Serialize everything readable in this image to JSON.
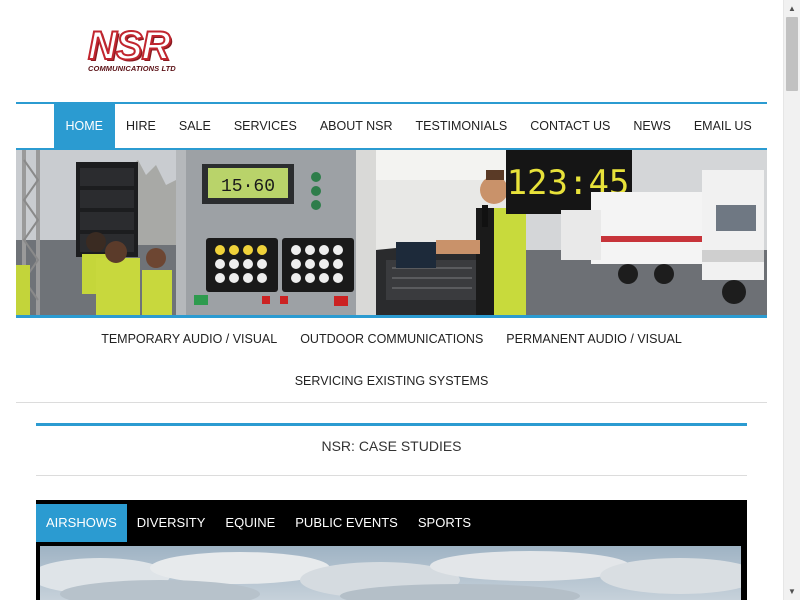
{
  "logo": {
    "main": "NSR",
    "sub": "COMMUNICATIONS LTD"
  },
  "main_nav": {
    "items": [
      {
        "label": "HOME",
        "active": true
      },
      {
        "label": "HIRE"
      },
      {
        "label": "SALE"
      },
      {
        "label": "SERVICES"
      },
      {
        "label": "ABOUT NSR"
      },
      {
        "label": "TESTIMONIALS"
      },
      {
        "label": "CONTACT US"
      },
      {
        "label": "NEWS"
      },
      {
        "label": "EMAIL US"
      }
    ]
  },
  "banner": {
    "clock_display": "123:45",
    "panel_display": "15·60"
  },
  "sub_nav": {
    "items": [
      {
        "label": "TEMPORARY AUDIO / VISUAL"
      },
      {
        "label": "OUTDOOR COMMUNICATIONS"
      },
      {
        "label": "PERMANENT AUDIO / VISUAL"
      },
      {
        "label": "SERVICING EXISTING SYSTEMS"
      }
    ]
  },
  "case_studies": {
    "title": "NSR: CASE STUDIES",
    "tabs": [
      {
        "label": "AIRSHOWS",
        "active": true
      },
      {
        "label": "DIVERSITY"
      },
      {
        "label": "EQUINE"
      },
      {
        "label": "PUBLIC EVENTS"
      },
      {
        "label": "SPORTS"
      }
    ]
  },
  "colors": {
    "accent": "#2b9bd1",
    "logo_red": "#c1262f"
  },
  "scrollbar": {
    "up_icon": "chevron-up-icon",
    "down_icon": "chevron-down-icon"
  }
}
